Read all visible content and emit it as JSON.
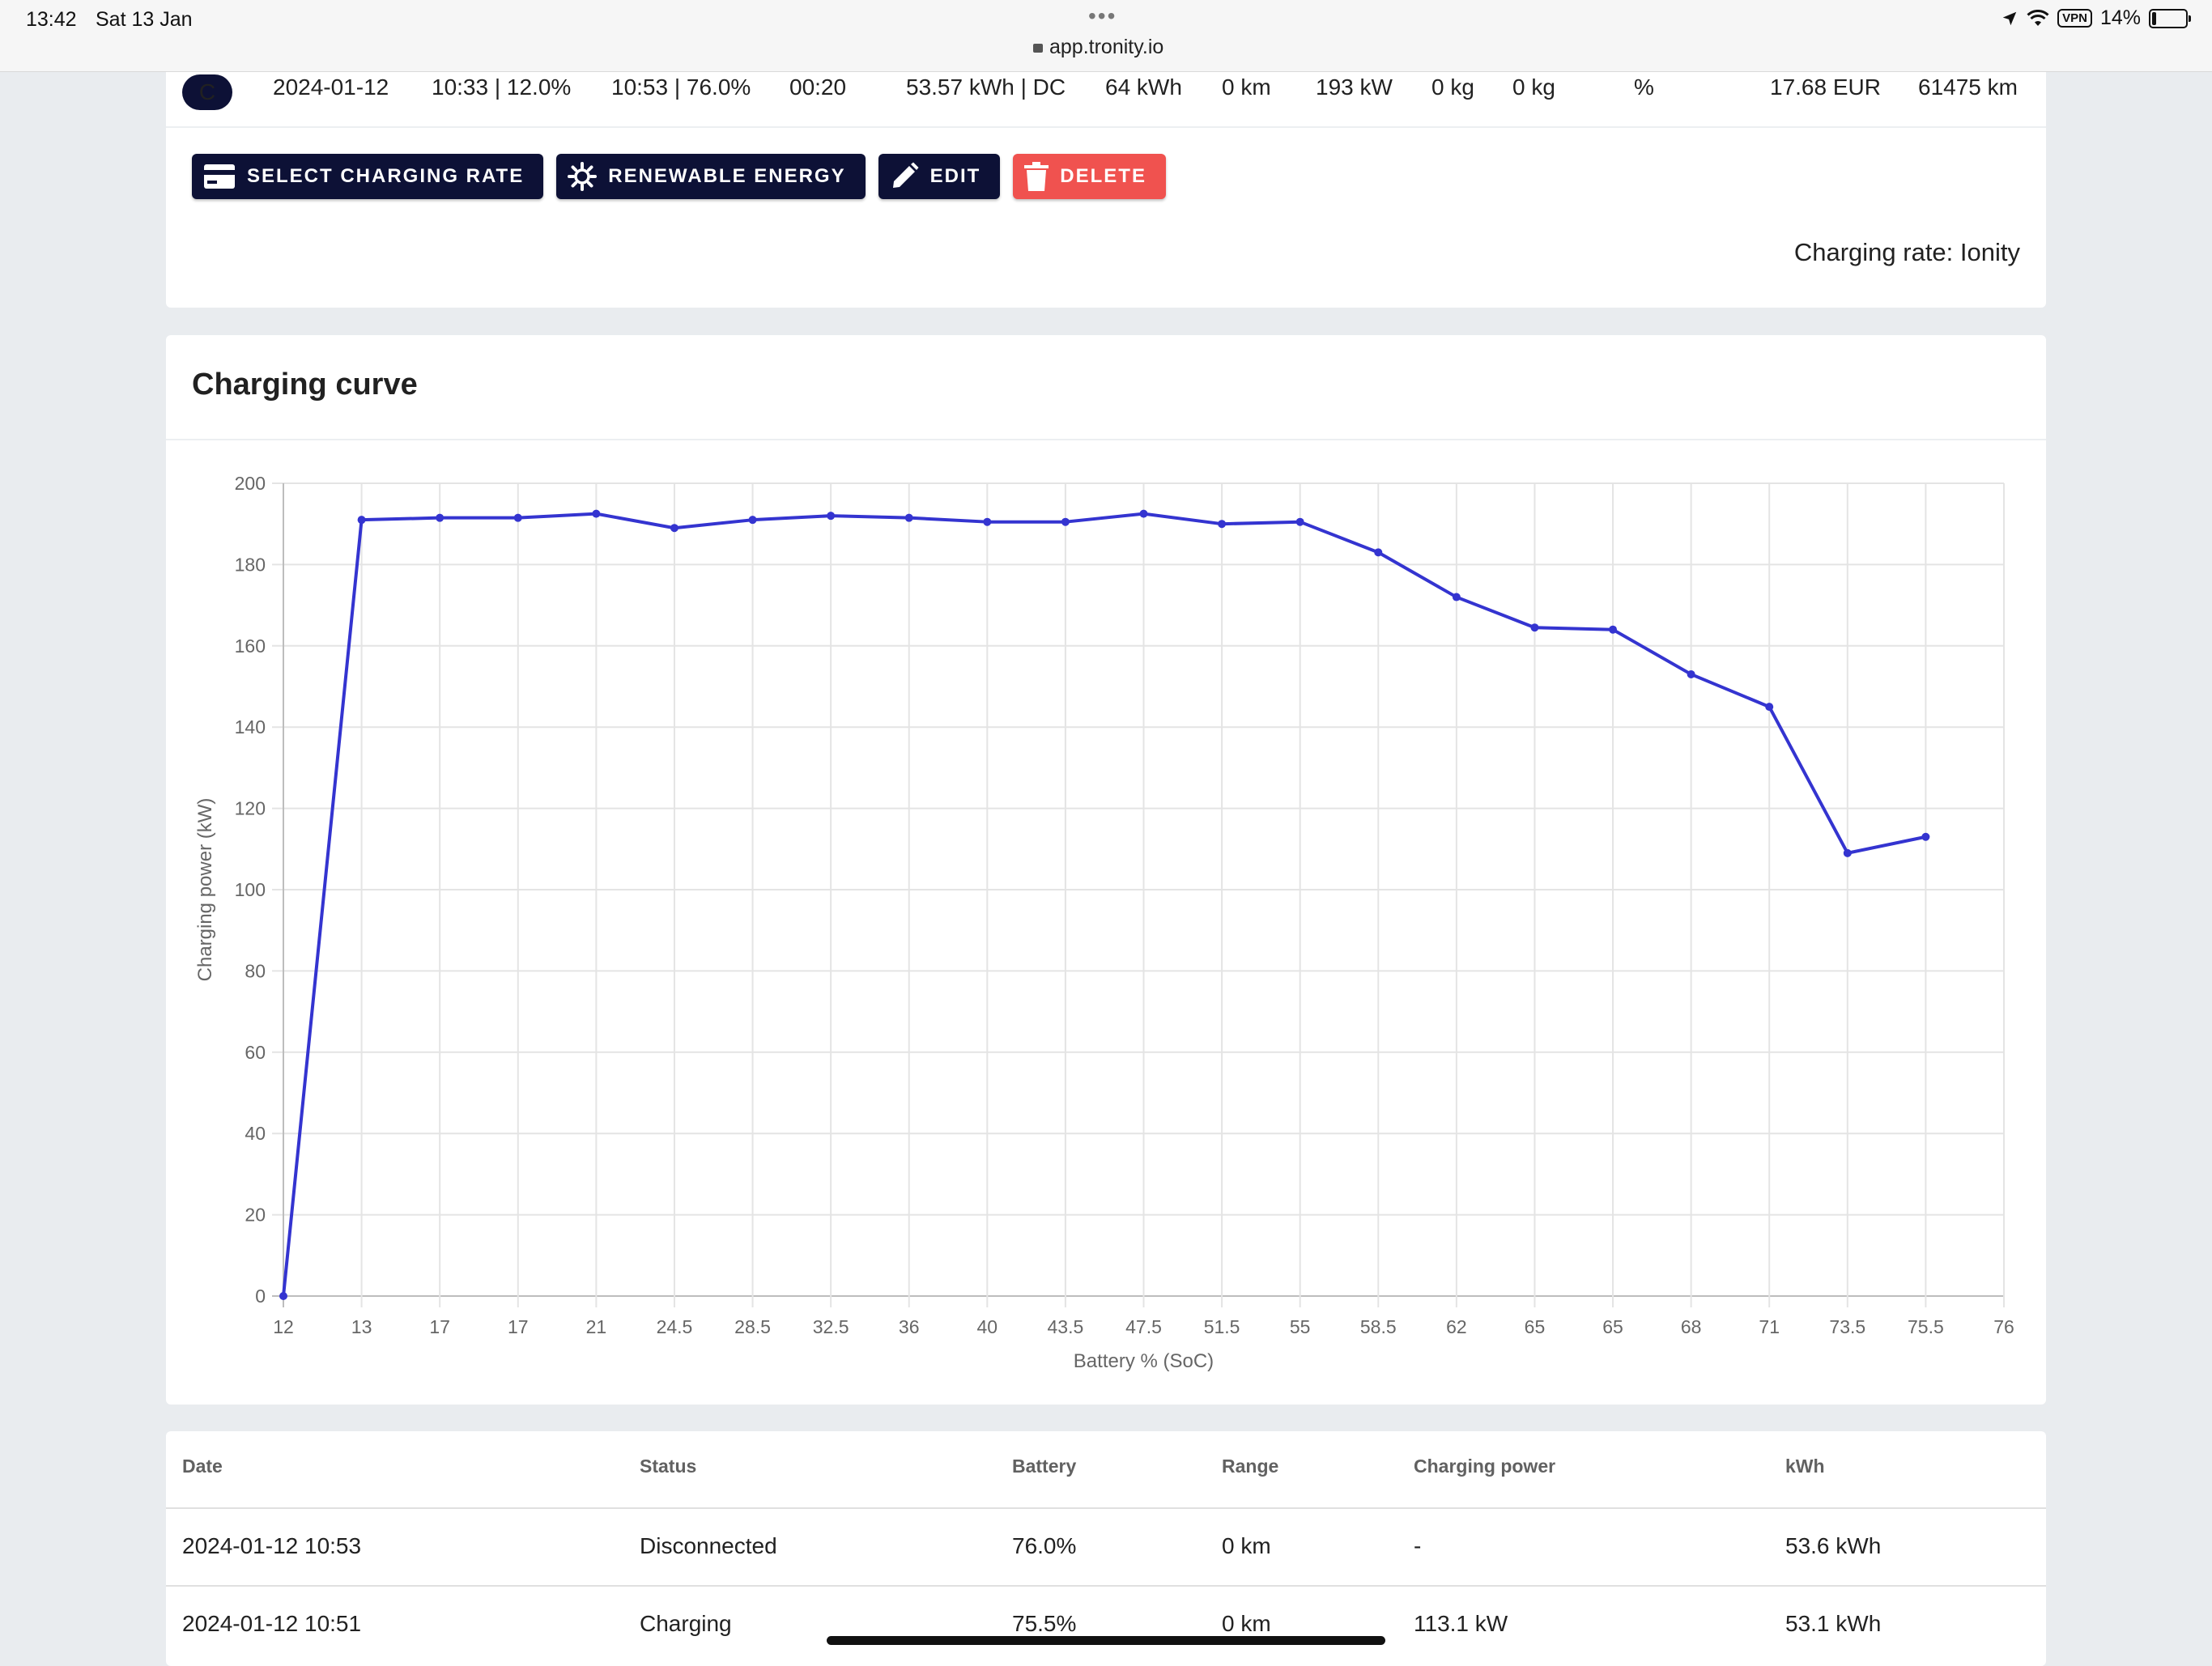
{
  "status_bar": {
    "time": "13:42",
    "date": "Sat 13 Jan",
    "dots": "•••",
    "url": "app.tronity.io",
    "vpn": "VPN",
    "battery": "14%",
    "battery_level": 0.14
  },
  "session": {
    "chip": "C",
    "date": "2024-01-12",
    "start": "10:33 | 12.0%",
    "end": "10:53 | 76.0%",
    "duration": "00:20",
    "energy": "53.57 kWh | DC",
    "capacity": "64 kWh",
    "range": "0 km",
    "max_power": "193 kW",
    "co2_a": "0 kg",
    "co2_b": "0 kg",
    "percent": "%",
    "cost": "17.68 EUR",
    "odometer": "61475 km"
  },
  "actions": {
    "select_rate": "SELECT CHARGING RATE",
    "renewable": "RENEWABLE ENERGY",
    "edit": "EDIT",
    "delete": "DELETE"
  },
  "charging_rate_text": "Charging rate: Ionity",
  "chart_card": {
    "title": "Charging curve"
  },
  "chart_data": {
    "type": "line",
    "title": "",
    "xlabel": "Battery % (SoC)",
    "ylabel": "Charging power (kW)",
    "categories": [
      "12",
      "13",
      "17",
      "17",
      "21",
      "24.5",
      "28.5",
      "32.5",
      "36",
      "40",
      "43.5",
      "47.5",
      "51.5",
      "55",
      "58.5",
      "62",
      "65",
      "65",
      "68",
      "71",
      "73.5",
      "75.5",
      "76"
    ],
    "series": [
      {
        "values": [
          0,
          191,
          191.5,
          191.5,
          192.5,
          189,
          191,
          192,
          191.5,
          190.5,
          190.5,
          192.5,
          190,
          190.5,
          183,
          172,
          164.5,
          164,
          153,
          145,
          109,
          113
        ]
      }
    ],
    "ylim": [
      0,
      200
    ],
    "yticks": [
      0,
      20,
      40,
      60,
      80,
      100,
      120,
      140,
      160,
      180,
      200
    ],
    "line_color": "#3434d0",
    "grid": true
  },
  "table": {
    "columns": [
      "Date",
      "Status",
      "Battery",
      "Range",
      "Charging power",
      "kWh"
    ],
    "rows": [
      [
        "2024-01-12 10:53",
        "Disconnected",
        "76.0%",
        "0 km",
        "-",
        "53.6 kWh"
      ],
      [
        "2024-01-12 10:51",
        "Charging",
        "75.5%",
        "0 km",
        "113.1 kW",
        "53.1 kWh"
      ]
    ]
  }
}
